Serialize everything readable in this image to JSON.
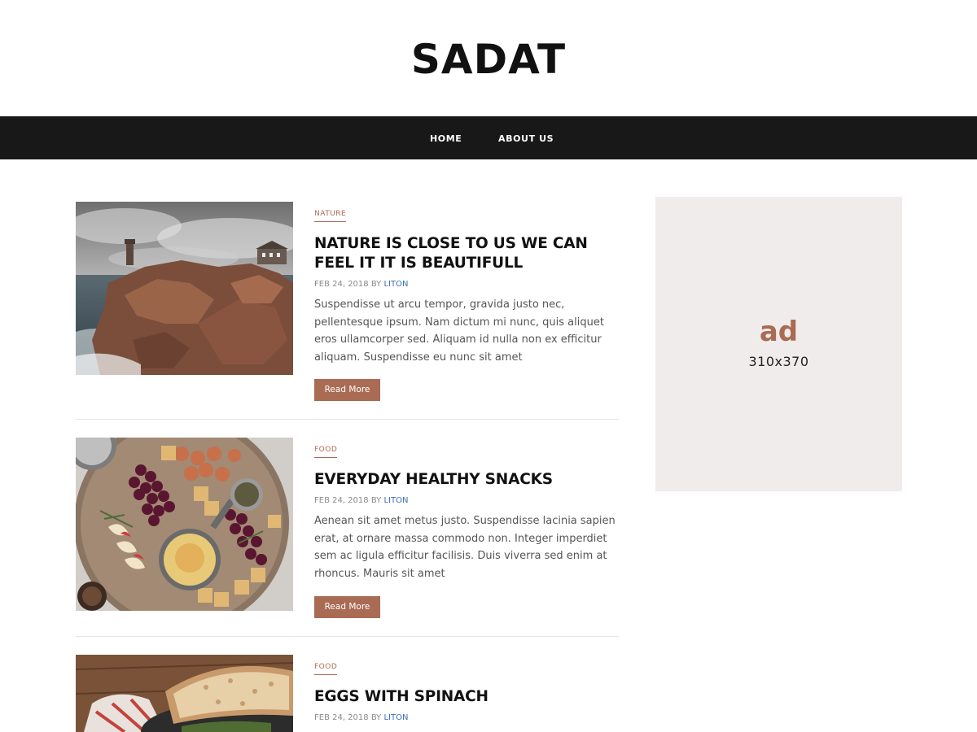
{
  "site": {
    "title": "SADAT"
  },
  "nav": {
    "items": [
      {
        "label": "HOME"
      },
      {
        "label": "ABOUT US"
      }
    ]
  },
  "posts": [
    {
      "category": "NATURE",
      "title": "NATURE IS CLOSE TO US WE CAN FEEL IT IT IS BEAUTIFULL",
      "date": "FEB 24, 2018",
      "by": "BY",
      "author": "LITON",
      "excerpt": "Suspendisse ut arcu tempor, gravida justo nec, pellentesque ipsum. Nam dictum mi nunc, quis aliquet eros ullamcorper sed. Aliquam id nulla non ex efficitur aliquam. Suspendisse eu nunc sit amet",
      "read_more": "Read More"
    },
    {
      "category": "FOOD",
      "title": "EVERYDAY HEALTHY SNACKS",
      "date": "FEB 24, 2018",
      "by": "BY",
      "author": "LITON",
      "excerpt": "Aenean sit amet metus justo. Suspendisse lacinia sapien erat, at ornare massa commodo non. Integer imperdiet sem ac ligula efficitur facilisis. Duis viverra sed enim at rhoncus. Mauris sit amet",
      "read_more": "Read More"
    },
    {
      "category": "FOOD",
      "title": "EGGS WITH SPINACH",
      "date": "FEB 24, 2018",
      "by": "BY",
      "author": "LITON"
    }
  ],
  "ad": {
    "label": "ad",
    "size": "310x370"
  },
  "colors": {
    "accent": "#a96b53",
    "nav_background": "#181818",
    "author_link": "#3d6fb6",
    "ad_background": "#efeceb"
  }
}
